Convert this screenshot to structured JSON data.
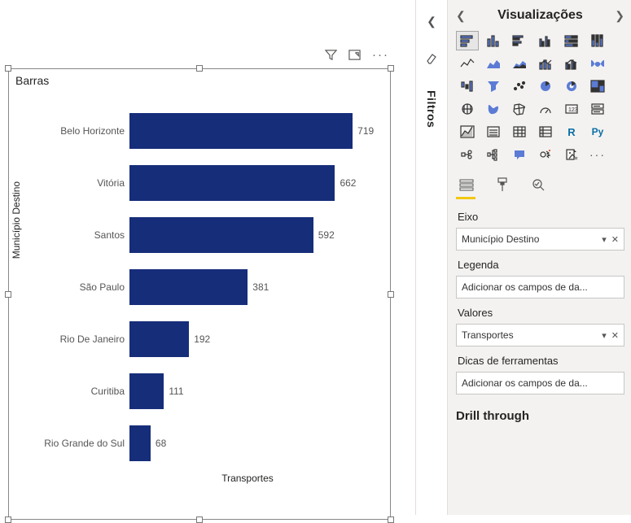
{
  "visual": {
    "title": "Barras",
    "x_axis_label": "Transportes",
    "y_axis_label": "Município Destino",
    "header_icons": {
      "filter": "filter-icon",
      "focus": "focus-mode-icon",
      "more": "more-options-icon"
    }
  },
  "chart_data": {
    "type": "bar",
    "title": "Barras",
    "xlabel": "Transportes",
    "ylabel": "Município Destino",
    "categories": [
      "Belo Horizonte",
      "Vitória",
      "Santos",
      "São Paulo",
      "Rio De Janeiro",
      "Curitiba",
      "Rio Grande do Sul"
    ],
    "values": [
      719,
      662,
      592,
      381,
      192,
      111,
      68
    ],
    "xlim": [
      0,
      720
    ],
    "bar_color": "#162d7a"
  },
  "filters_rail": {
    "label": "Filtros"
  },
  "viz_pane": {
    "title": "Visualizações",
    "wells": {
      "axis": {
        "label": "Eixo",
        "value": "Município Destino"
      },
      "legend": {
        "label": "Legenda",
        "placeholder": "Adicionar os campos de da..."
      },
      "values": {
        "label": "Valores",
        "value": "Transportes"
      },
      "tooltips": {
        "label": "Dicas de ferramentas",
        "placeholder": "Adicionar os campos de da..."
      }
    },
    "drill_through_title": "Drill through"
  }
}
